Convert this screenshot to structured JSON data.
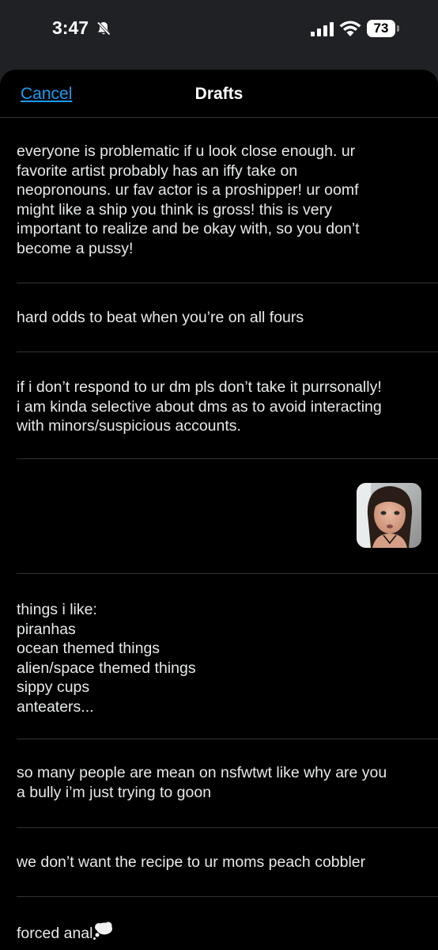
{
  "status_bar": {
    "time": "3:47",
    "battery": "73",
    "icons": [
      "bell-slash-icon",
      "cellular-signal-icon",
      "wifi-icon",
      "battery-icon"
    ]
  },
  "header": {
    "cancel_label": "Cancel",
    "title": "Drafts"
  },
  "drafts": [
    {
      "text": "everyone is problematic if u look close enough. ur\nfavorite artist probably has an iffy take on\nneopronouns. ur fav actor is a proshipper! ur oomf\nmight like a ship you think is gross! this is very\nimportant to realize and be okay with, so you don’t\nbecome a pussy!"
    },
    {
      "text": "hard odds to beat when you’re on all fours"
    },
    {
      "text": "if i don’t respond to ur dm pls don’t take it purrsonally!\ni am kinda selective about dms as to avoid interacting\nwith minors/suspicious accounts."
    },
    {
      "text": "",
      "media": "photo-thumbnail"
    },
    {
      "text": "things i like:\npiranhas\nocean themed things\nalien/space themed things\nsippy cups\nanteaters..."
    },
    {
      "text": "so many people are mean on nsfwtwt like why are you\na bully i’m just trying to goon"
    },
    {
      "text": "we don’t want the recipe to ur moms peach cobbler"
    },
    {
      "text": "forced anal",
      "emoji": "thought-balloon-icon"
    }
  ],
  "colors": {
    "background": "#000000",
    "status_bar_bg": "#202124",
    "text": "#e7e9ea",
    "accent": "#1d9bf0",
    "divider": "#2f3336"
  }
}
